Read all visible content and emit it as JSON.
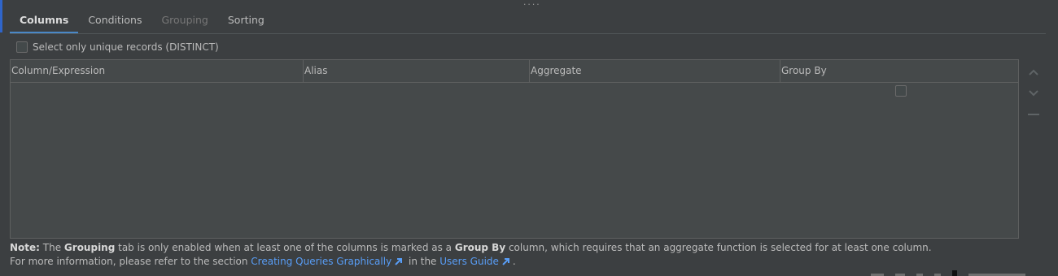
{
  "drag_handle": "....",
  "tabs": [
    {
      "label": "Columns",
      "state": "active"
    },
    {
      "label": "Conditions",
      "state": "normal"
    },
    {
      "label": "Grouping",
      "state": "disabled"
    },
    {
      "label": "Sorting",
      "state": "normal"
    }
  ],
  "distinct": {
    "label": "Select only unique records (DISTINCT)",
    "checked": false
  },
  "table": {
    "columns": [
      "Column/Expression",
      "Alias",
      "Aggregate",
      "Group By"
    ],
    "rows": [
      {
        "column_expression": "",
        "alias": "",
        "aggregate": "",
        "group_by": false
      }
    ]
  },
  "side_tools": [
    "move-up-icon",
    "move-down-icon",
    "remove-icon"
  ],
  "note": {
    "prefix_bold": "Note:",
    "text_1": " The ",
    "grouping_bold": "Grouping",
    "text_2": " tab is only enabled when at least one of the columns is marked as a ",
    "groupby_bold": "Group By",
    "text_3": " column, which requires that an aggregate function is selected for at least one column.",
    "line2_prefix": "For more information, please refer to the section ",
    "link_1": "Creating Queries Graphically",
    "line2_mid": " in the ",
    "link_2": "Users Guide",
    "line2_suffix": "."
  },
  "colors": {
    "background": "#3c3f41",
    "accent": "#4a88c7",
    "link": "#589df6"
  }
}
